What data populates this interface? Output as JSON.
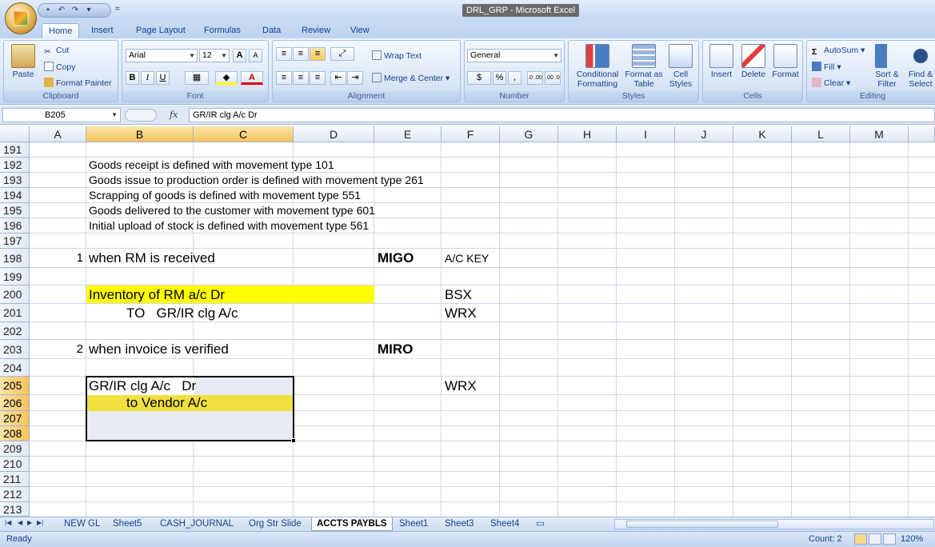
{
  "window": {
    "title": "DRL_GRP - Microsoft Excel"
  },
  "ribbon_tabs": [
    "Home",
    "Insert",
    "Page Layout",
    "Formulas",
    "Data",
    "Review",
    "View"
  ],
  "clipboard": {
    "paste": "Paste",
    "cut": "Cut",
    "copy": "Copy",
    "format_painter": "Format Painter",
    "label": "Clipboard"
  },
  "font": {
    "name": "Arial",
    "size": "12",
    "grow": "A",
    "shrink": "A",
    "bold": "B",
    "italic": "I",
    "underline": "U",
    "color_letter": "A",
    "label": "Font"
  },
  "alignment": {
    "wrap": "Wrap Text",
    "merge": "Merge & Center",
    "label": "Alignment"
  },
  "number": {
    "format": "General",
    "currency": "$",
    "percent": "%",
    "comma": ",",
    "inc_dec": ".0 .00",
    "dec_dec": ".00 .0",
    "label": "Number"
  },
  "styles": {
    "conditional": "Conditional Formatting",
    "format_table": "Format as Table",
    "cell_styles": "Cell Styles",
    "label": "Styles"
  },
  "cells": {
    "insert": "Insert",
    "delete": "Delete",
    "format": "Format",
    "label": "Cells"
  },
  "editing": {
    "autosum": "AutoSum",
    "fill": "Fill",
    "clear": "Clear",
    "sort": "Sort & Filter",
    "find": "Find & Select",
    "label": "Editing"
  },
  "formula_bar": {
    "name_box": "B205",
    "fx": "fx",
    "content": "GR/IR clg A/c   Dr"
  },
  "columns": [
    "A",
    "B",
    "C",
    "D",
    "E",
    "F",
    "G",
    "H",
    "I",
    "J",
    "K",
    "L",
    "M"
  ],
  "rows": [
    "191",
    "192",
    "193",
    "194",
    "195",
    "196",
    "197",
    "198",
    "199",
    "200",
    "201",
    "202",
    "203",
    "204",
    "205",
    "206",
    "207",
    "208",
    "209",
    "210",
    "211",
    "212",
    "213"
  ],
  "cells_content": {
    "r192": "Goods receipt is defined with movement type 101",
    "r193": "Goods issue to production order is defined with movement type 261",
    "r194": "Scrapping of goods is defined with movement type 551",
    "r195": "Goods delivered to the customer with movement type 601",
    "r196": "Initial upload of stock is defined with movement type 561",
    "a198": "1",
    "b198": "when RM is received",
    "e198": "MIGO",
    "f198": "A/C KEY",
    "b200": "Inventory of RM a/c Dr",
    "f200": "BSX",
    "b201": "TO   GR/IR clg A/c",
    "f201": "WRX",
    "a203": "2",
    "b203": "when invoice is verified",
    "e203": "MIRO",
    "b205": "GR/IR clg A/c   Dr",
    "f205": "WRX",
    "b206": "to Vendor A/c"
  },
  "sheet_tabs": [
    "NEW GL",
    "Sheet5",
    "CASH_JOURNAL",
    "Org Str Slide",
    "ACCTS PAYBLS",
    "Sheet1",
    "Sheet3",
    "Sheet4"
  ],
  "active_sheet": "ACCTS PAYBLS",
  "status": {
    "ready": "Ready",
    "count": "Count: 2",
    "zoom": "120%"
  },
  "colors": {
    "highlight_yellow": "#ffff00",
    "highlight_gold": "#f0e040",
    "selected_header": "#f7c25c",
    "ribbon": "#dce8f8"
  }
}
